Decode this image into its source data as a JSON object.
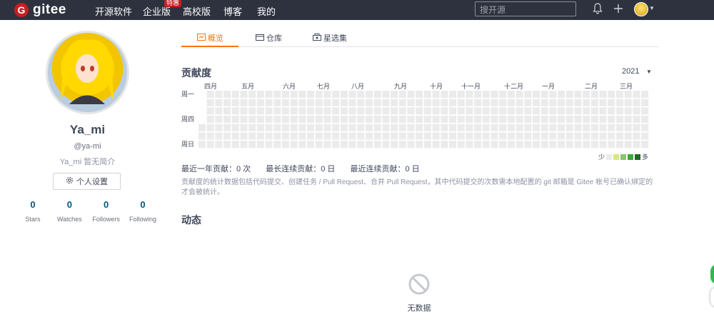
{
  "nav": {
    "logo_text": "gitee",
    "logo_mark": "G",
    "items": [
      "开源软件",
      "企业版",
      "高校版",
      "博客",
      "我的"
    ],
    "badge": "特惠",
    "search_placeholder": "搜开源",
    "icons": [
      "bell-icon",
      "plus-icon",
      "avatar",
      "chevron-down-icon"
    ]
  },
  "profile": {
    "name": "Ya_mi",
    "handle": "@ya-mi",
    "bio": "Ya_mi 暂无简介",
    "settings_label": "个人设置",
    "stats": [
      {
        "value": "0",
        "label": "Stars"
      },
      {
        "value": "0",
        "label": "Watches"
      },
      {
        "value": "0",
        "label": "Followers"
      },
      {
        "value": "0",
        "label": "Following"
      }
    ]
  },
  "tabs": [
    {
      "label": "概览",
      "active": true
    },
    {
      "label": "仓库",
      "active": false
    },
    {
      "label": "星选集",
      "active": false
    }
  ],
  "contributions": {
    "title": "贡献度",
    "year": "2021",
    "months": [
      "四月",
      "五月",
      "六月",
      "七月",
      "八月",
      "九月",
      "十月",
      "十一月",
      "十二月",
      "一月",
      "二月",
      "三月"
    ],
    "weekdays": [
      "周一",
      "周四",
      "周日"
    ],
    "legend_less": "少",
    "legend_more": "多",
    "legend_colors": [
      "#ebebeb",
      "#d6e685",
      "#8cc665",
      "#44a340",
      "#1e6823"
    ],
    "empty_color": "#ebebeb",
    "summary": [
      "最近一年贡献：0 次",
      "最长连续贡献：0 日",
      "最近连续贡献：0 日"
    ],
    "note": "贡献度的统计数据包括代码提交、创建任务 / Pull Request、合并 Pull Request，其中代码提交的次数需本地配置的 git 邮箱是 Gitee 帐号已确认绑定的才会被统计。"
  },
  "activity": {
    "title": "动态",
    "empty_text": "无数据"
  },
  "colors": {
    "nav_bg": "#2e323e",
    "accent": "#fe7300",
    "brand": "#c71d23",
    "stat_color": "#005980"
  }
}
